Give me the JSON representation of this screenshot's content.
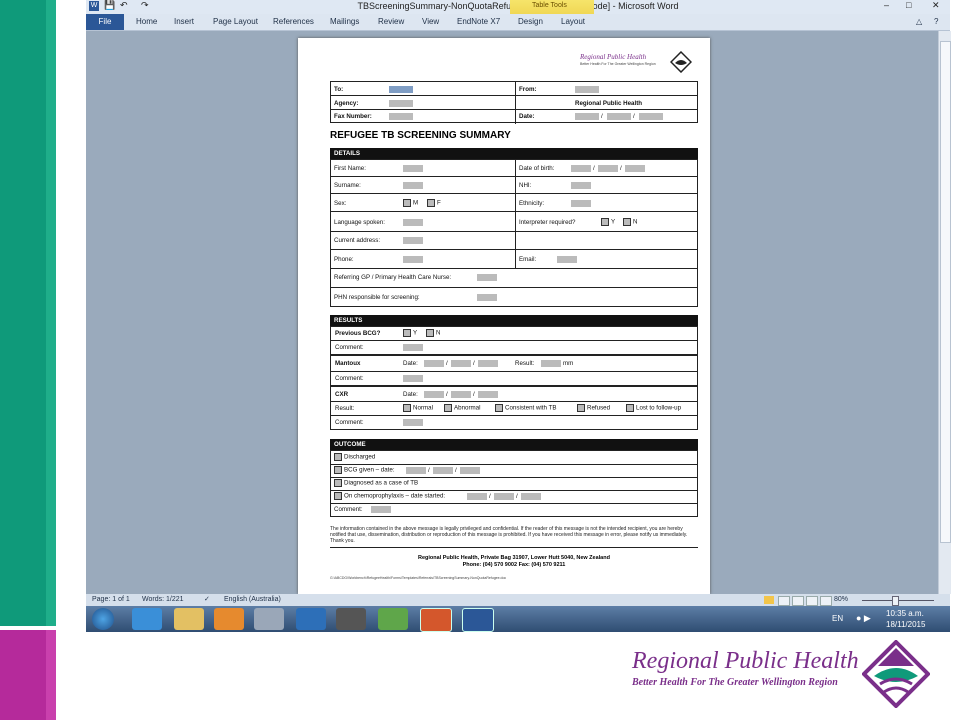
{
  "window": {
    "title": "TBScreeningSummary-NonQuotaRefugee [Compatibility Mode] - Microsoft Word"
  },
  "ribbon": {
    "tabs": [
      "File",
      "Home",
      "Insert",
      "Page Layout",
      "References",
      "Mailings",
      "Review",
      "View",
      "EndNote X7",
      "Design",
      "Layout"
    ],
    "context_label": "Table Tools"
  },
  "status": {
    "page": "Page: 1 of 1",
    "words": "Words: 1/221",
    "language": "English (Australia)",
    "zoom": "80%"
  },
  "clock": {
    "time": "10:35 a.m.",
    "date": "18/11/2015",
    "lang": "EN"
  },
  "doc": {
    "brand": "Regional Public Health",
    "brand_sub": "Better Health For The Greater Wellington Region",
    "fax": {
      "to": "To:",
      "from": "From:",
      "agency": "Agency:",
      "rph": "Regional Public Health",
      "fax_number": "Fax Number:",
      "date": "Date:"
    },
    "heading": "REFUGEE TB SCREENING SUMMARY",
    "details": {
      "header": "DETAILS",
      "first_name": "First Name:",
      "dob": "Date of birth:",
      "surname": "Surname:",
      "nhi": "NHI:",
      "sex": "Sex:",
      "m": "M",
      "f": "F",
      "ethnicity": "Ethnicity:",
      "language": "Language spoken:",
      "interpreter": "Interpreter required?",
      "y": "Y",
      "n": "N",
      "address": "Current address:",
      "phone": "Phone:",
      "email": "Email:",
      "gp": "Referring GP / Primary Health Care Nurse:",
      "phn": "PHN responsible for screening:"
    },
    "results": {
      "header": "RESULTS",
      "bcg": "Previous BCG?",
      "comment": "Comment:",
      "mantoux": "Mantoux",
      "date": "Date:",
      "result": "Result:",
      "mm": "mm",
      "cxr": "CXR",
      "result_label": "Result:",
      "opts": [
        "Normal",
        "Abnormal",
        "Consistent with TB",
        "Refused",
        "Lost to follow-up"
      ]
    },
    "outcome": {
      "header": "OUTCOME",
      "items": [
        "Discharged",
        "BCG given – date:",
        "Diagnosed as a case of TB",
        "On chemoprophylaxis – date started:"
      ],
      "comment": "Comment:"
    },
    "disclaimer": "The information contained in the above message is legally privileged and confidential.  If the reader of this message is not the intended recipient, you are hereby notified that use, dissemination, distribution or reproduction of this message is prohibited.  If you have received this message in error, please notify us immediately.  Thank you.",
    "address_line": "Regional Public Health, Private Bag 31907, Lower Hutt 5040, New Zealand",
    "phone_line": "Phone: (04) 570 9002 Fax: (04) 570 9211",
    "path": "G:\\ABCDG\\Workbench\\RefugeeHealth\\Forms\\Templates\\Referrals\\TBScreeningSummary-NonQuotaRefugee.doc"
  },
  "footer_logo": {
    "title": "Regional Public Health",
    "subtitle": "Better Health For The Greater Wellington Region"
  },
  "colors": {
    "teal": "#0f9a7a",
    "magenta": "#b52a9b",
    "brand": "#7a2f8a"
  }
}
